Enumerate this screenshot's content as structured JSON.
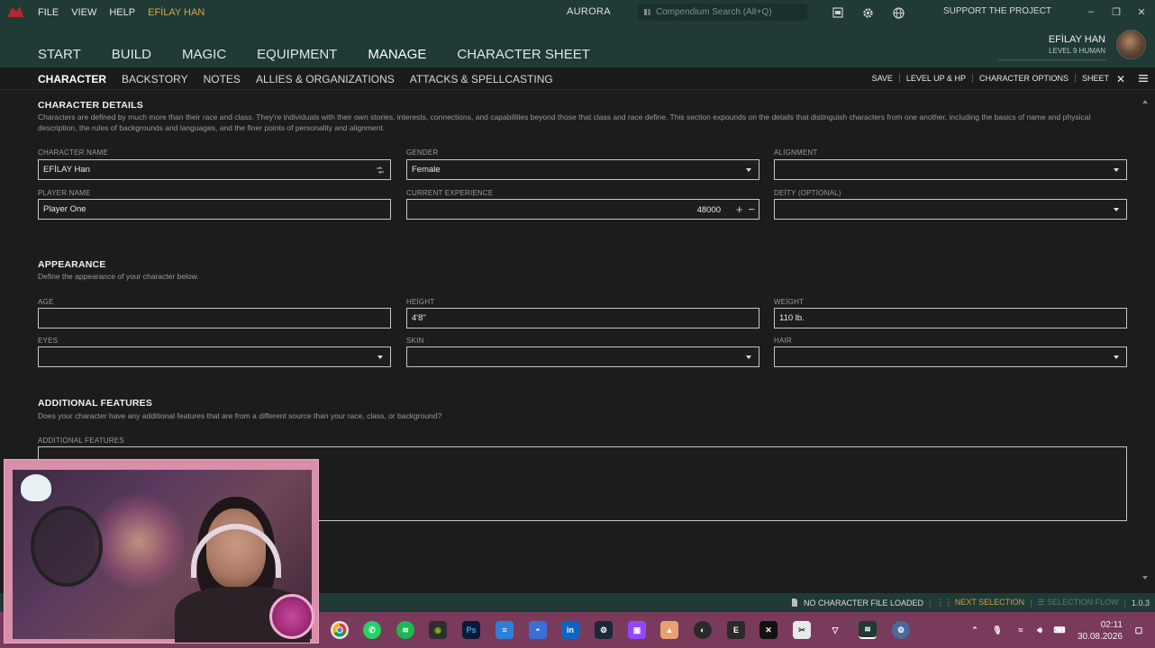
{
  "titlebar": {
    "menu": [
      "FILE",
      "VIEW",
      "HELP"
    ],
    "character_menu": "EFİLAY HAN",
    "app_title": "AURORA",
    "search_placeholder": "Compendium Search (Alt+Q)",
    "support": "SUPPORT THE PROJECT"
  },
  "mainnav": {
    "items": [
      "START",
      "BUILD",
      "MAGIC",
      "EQUIPMENT",
      "MANAGE",
      "CHARACTER SHEET"
    ],
    "active": "MANAGE",
    "user_name": "EFİLAY HAN",
    "user_level": "LEVEL 9 HUMAN"
  },
  "subnav": {
    "tabs": [
      "CHARACTER",
      "BACKSTORY",
      "NOTES",
      "ALLIES & ORGANIZATIONS",
      "ATTACKS & SPELLCASTING"
    ],
    "active": "CHARACTER",
    "actions": [
      "SAVE",
      "LEVEL UP & HP",
      "CHARACTER OPTIONS",
      "SHEET"
    ]
  },
  "details": {
    "title": "CHARACTER DETAILS",
    "description": "Characters are defined by much more than their race and class. They're individuals with their own stories, interests, connections, and capabilities beyond those that class and race define. This section expounds on the details that distinguish characters from one another, including the basics of name and physical description, the rules of backgrounds and languages, and the finer points of personality and alignment.",
    "character_name_label": "CHARACTER NAME",
    "character_name": "EFİLAY Han",
    "gender_label": "GENDER",
    "gender": "Female",
    "alignment_label": "ALİGNMENT",
    "alignment": "",
    "player_name_label": "PLAYER NAME",
    "player_name": "Player One",
    "experience_label": "CURRENT EXPERIENCE",
    "experience": "48000",
    "deity_label": "DEİTY (OPTİONAL)",
    "deity": ""
  },
  "appearance": {
    "title": "APPEARANCE",
    "description": "Define the appearance of your character below.",
    "age_label": "AGE",
    "age": "",
    "height_label": "HEİGHT",
    "height": "4'8\"",
    "weight_label": "WEİGHT",
    "weight": "110 lb.",
    "eyes_label": "EYES",
    "skin_label": "SKIN",
    "hair_label": "HAIR"
  },
  "additional": {
    "title": "ADDITIONAL FEATURES",
    "description": "Does your character have any additional features that are from a different source than your race, class, or background?",
    "label": "ADDITIONAL FEATURES"
  },
  "statusbar": {
    "file": "NO CHARACTER FILE LOADED",
    "next": "NEXT SELECTION",
    "flow": "SELECTION FLOW",
    "version": "1.0.3"
  },
  "taskbar": {
    "time": "02:11",
    "date": "30.08.2026"
  },
  "colors": {
    "header_bg": "#203a36",
    "accent_gold": "#d7a94a",
    "body_bg": "#1b1c1c",
    "taskbar_bg": "#7a3a5c"
  }
}
